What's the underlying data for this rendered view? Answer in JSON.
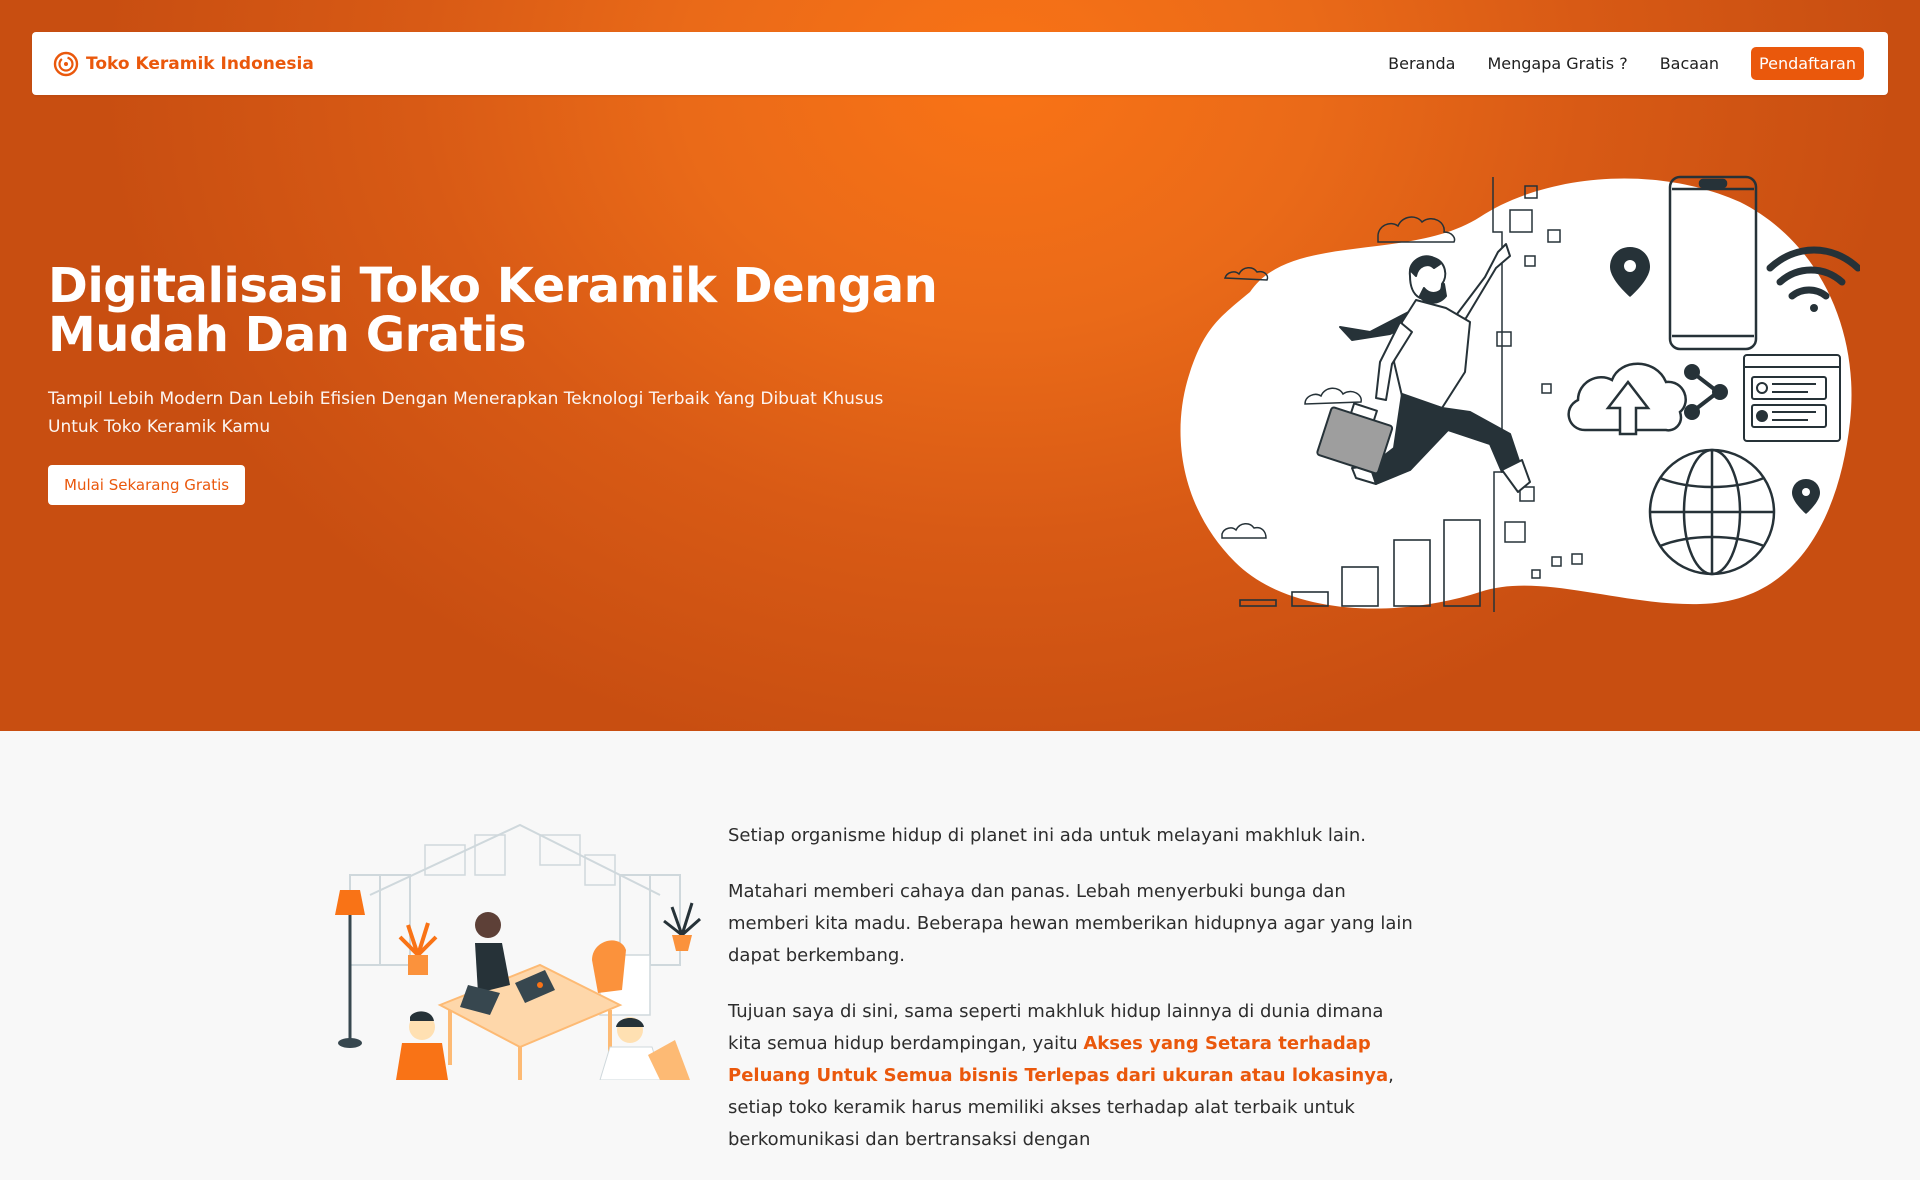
{
  "nav": {
    "brand": "Toko Keramik Indonesia",
    "links": [
      "Beranda",
      "Mengapa Gratis ?",
      "Bacaan"
    ],
    "cta": "Pendaftaran"
  },
  "hero": {
    "title": "Digitalisasi Toko Keramik Dengan Mudah Dan Gratis",
    "subtitle": "Tampil Lebih Modern Dan Lebih Efisien Dengan Menerapkan Teknologi Terbaik Yang Dibuat Khusus Untuk Toko Keramik Kamu",
    "button": "Mulai Sekarang Gratis"
  },
  "content": {
    "p1": "Setiap organisme hidup di planet ini ada untuk melayani makhluk lain.",
    "p2": "Matahari memberi cahaya dan panas. Lebah menyerbuki bunga dan memberi kita madu. Beberapa hewan memberikan hidupnya agar yang lain dapat berkembang.",
    "p3_before": "Tujuan saya di sini, sama seperti makhluk hidup lainnya di dunia dimana kita semua hidup berdampingan, yaitu ",
    "p3_highlight": "Akses yang Setara terhadap Peluang Untuk Semua bisnis Terlepas dari ukuran atau lokasinya",
    "p3_after": ", setiap toko keramik harus memiliki akses terhadap alat terbaik untuk berkomunikasi dan bertransaksi dengan"
  },
  "colors": {
    "accent": "#ea580c",
    "hero_bg": "#e8641a",
    "dark_ink": "#263238"
  },
  "icons": [
    "logo-ring-icon",
    "map-pin-icon",
    "wifi-icon",
    "cloud-upload-icon",
    "share-icon",
    "globe-icon",
    "smartphone-icon"
  ]
}
